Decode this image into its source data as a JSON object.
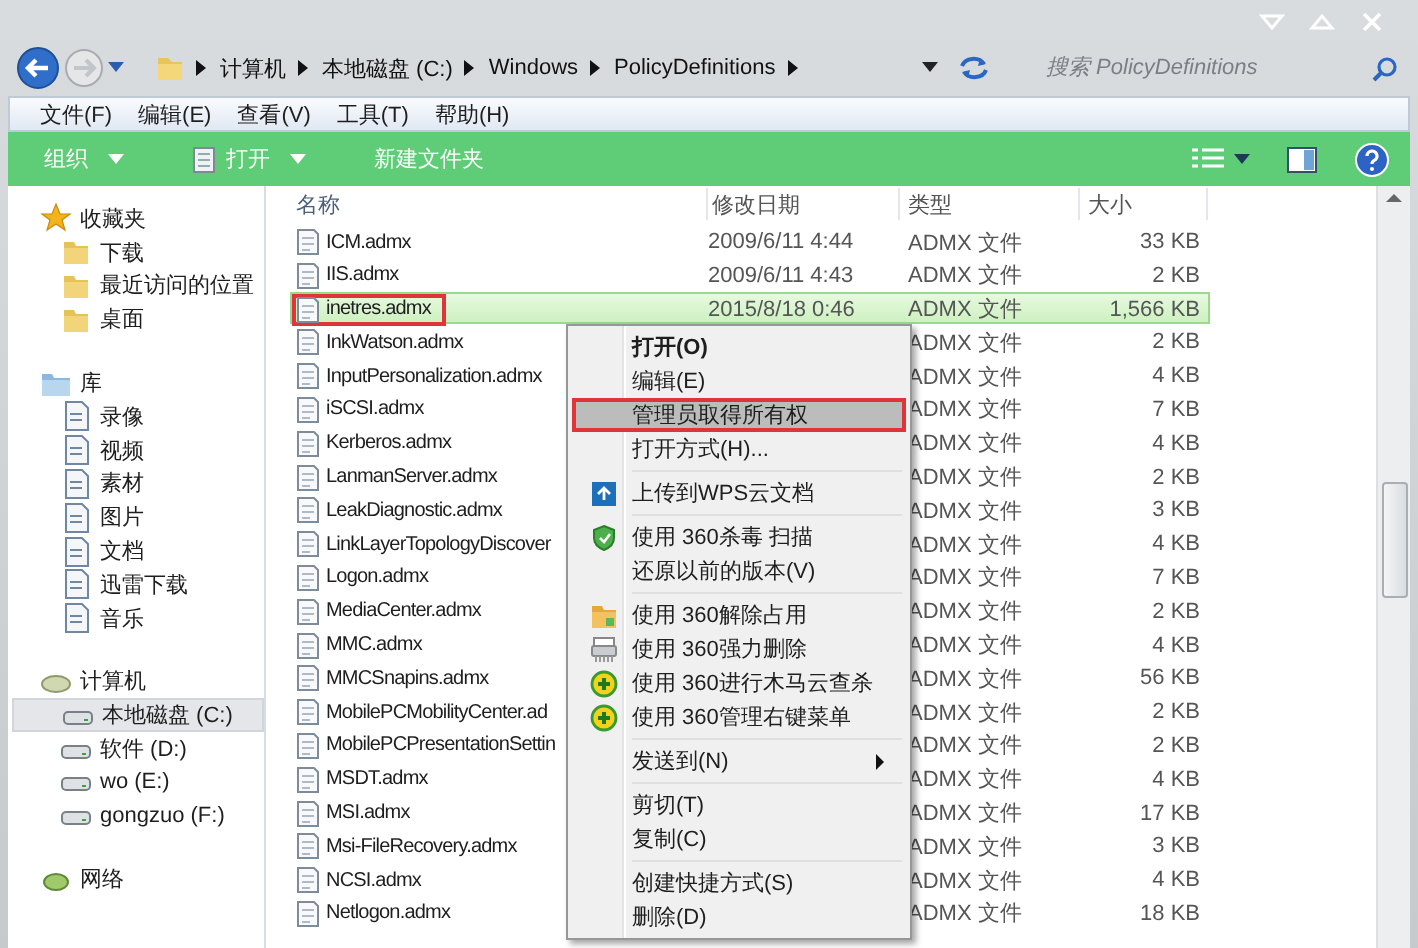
{
  "address_bar": {
    "breadcrumb": [
      "计算机",
      "本地磁盘 (C:)",
      "Windows",
      "PolicyDefinitions"
    ]
  },
  "search": {
    "placeholder": "搜索 PolicyDefinitions"
  },
  "menu_bar": [
    "文件(F)",
    "编辑(E)",
    "查看(V)",
    "工具(T)",
    "帮助(H)"
  ],
  "toolbar": [
    {
      "label": "组织",
      "kind": "plain",
      "dropdown": true
    },
    {
      "label": "打开",
      "kind": "document",
      "dropdown": true
    },
    {
      "label": "新建文件夹",
      "kind": "plain",
      "dropdown": false
    }
  ],
  "sidebar": {
    "groups": [
      {
        "label": "收藏夹",
        "selected": false,
        "children": [
          {
            "label": "下载",
            "selected": false
          },
          {
            "label": "最近访问的位置",
            "selected": false
          },
          {
            "label": "桌面",
            "selected": false
          }
        ]
      },
      {
        "label": "库",
        "selected": false,
        "children": [
          {
            "label": "录像",
            "selected": false
          },
          {
            "label": "视频",
            "selected": false
          },
          {
            "label": "素材",
            "selected": false
          },
          {
            "label": "图片",
            "selected": false
          },
          {
            "label": "文档",
            "selected": false
          },
          {
            "label": "迅雷下载",
            "selected": false
          },
          {
            "label": "音乐",
            "selected": false
          }
        ]
      },
      {
        "label": "计算机",
        "selected": false,
        "children": [
          {
            "label": "本地磁盘 (C:)",
            "selected": true
          },
          {
            "label": "软件 (D:)",
            "selected": false
          },
          {
            "label": "wo (E:)",
            "selected": false
          },
          {
            "label": "gongzuo (F:)",
            "selected": false
          }
        ]
      },
      {
        "label": "网络",
        "selected": false
      }
    ]
  },
  "file_list": {
    "columns": [
      "名称",
      "修改日期",
      "类型",
      "大小"
    ],
    "rows": [
      {
        "name": "ICM.admx",
        "date": "2009/6/11 4:44",
        "type": "ADMX 文件",
        "size": "33 KB",
        "selected": false,
        "marked": false
      },
      {
        "name": "IIS.admx",
        "date": "2009/6/11 4:43",
        "type": "ADMX 文件",
        "size": "2 KB",
        "selected": false,
        "marked": false
      },
      {
        "name": "inetres.admx",
        "date": "2015/8/18 0:46",
        "type": "ADMX 文件",
        "size": "1,566 KB",
        "selected": true,
        "marked": true
      },
      {
        "name": "InkWatson.admx",
        "type": "ADMX 文件",
        "size": "2 KB",
        "selected": false,
        "marked": false
      },
      {
        "name": "InputPersonalization.admx",
        "type": "ADMX 文件",
        "size": "4 KB",
        "selected": false,
        "marked": false
      },
      {
        "name": "iSCSI.admx",
        "type": "ADMX 文件",
        "size": "7 KB",
        "selected": false,
        "marked": false
      },
      {
        "name": "Kerberos.admx",
        "type": "ADMX 文件",
        "size": "4 KB",
        "selected": false,
        "marked": false
      },
      {
        "name": "LanmanServer.admx",
        "type": "ADMX 文件",
        "size": "2 KB",
        "selected": false,
        "marked": false
      },
      {
        "name": "LeakDiagnostic.admx",
        "type": "ADMX 文件",
        "size": "3 KB",
        "selected": false,
        "marked": false
      },
      {
        "name": "LinkLayerTopologyDiscover",
        "type": "ADMX 文件",
        "size": "4 KB",
        "selected": false,
        "marked": false
      },
      {
        "name": "Logon.admx",
        "type": "ADMX 文件",
        "size": "7 KB",
        "selected": false,
        "marked": false
      },
      {
        "name": "MediaCenter.admx",
        "type": "ADMX 文件",
        "size": "2 KB",
        "selected": false,
        "marked": false
      },
      {
        "name": "MMC.admx",
        "type": "ADMX 文件",
        "size": "4 KB",
        "selected": false,
        "marked": false
      },
      {
        "name": "MMCSnapins.admx",
        "type": "ADMX 文件",
        "size": "56 KB",
        "selected": false,
        "marked": false
      },
      {
        "name": "MobilePCMobilityCenter.ad",
        "type": "ADMX 文件",
        "size": "2 KB",
        "selected": false,
        "marked": false
      },
      {
        "name": "MobilePCPresentationSettin",
        "type": "ADMX 文件",
        "size": "2 KB",
        "selected": false,
        "marked": false
      },
      {
        "name": "MSDT.admx",
        "type": "ADMX 文件",
        "size": "4 KB",
        "selected": false,
        "marked": false
      },
      {
        "name": "MSI.admx",
        "type": "ADMX 文件",
        "size": "17 KB",
        "selected": false,
        "marked": false
      },
      {
        "name": "Msi-FileRecovery.admx",
        "type": "ADMX 文件",
        "size": "3 KB",
        "selected": false,
        "marked": false
      },
      {
        "name": "NCSI.admx",
        "type": "ADMX 文件",
        "size": "4 KB",
        "selected": false,
        "marked": false
      },
      {
        "name": "Netlogon.admx",
        "type": "ADMX 文件",
        "size": "18 KB",
        "selected": false,
        "marked": false
      }
    ]
  },
  "context_menu": {
    "items": [
      {
        "kind": "default",
        "label": "打开(O)",
        "highlighted": false,
        "marked": false
      },
      {
        "kind": "plain",
        "label": "编辑(E)",
        "highlighted": false,
        "marked": false
      },
      {
        "kind": "plain",
        "label": "管理员取得所有权",
        "highlighted": true,
        "marked": true
      },
      {
        "kind": "plain",
        "label": "打开方式(H)...",
        "highlighted": false,
        "marked": false
      },
      {
        "kind": "separator"
      },
      {
        "kind": "cloud",
        "label": "上传到WPS云文档",
        "highlighted": false,
        "marked": false
      },
      {
        "kind": "separator"
      },
      {
        "kind": "antivirus",
        "label": "使用 360杀毒 扫描",
        "highlighted": false,
        "marked": false
      },
      {
        "kind": "plain",
        "label": "还原以前的版本(V)",
        "highlighted": false,
        "marked": false
      },
      {
        "kind": "separator"
      },
      {
        "kind": "unlock",
        "label": "使用 360解除占用",
        "highlighted": false,
        "marked": false
      },
      {
        "kind": "shred",
        "label": "使用 360强力删除",
        "highlighted": false,
        "marked": false
      },
      {
        "kind": "plus",
        "label": "使用 360进行木马云查杀",
        "highlighted": false,
        "marked": false
      },
      {
        "kind": "plus",
        "label": "使用 360管理右键菜单",
        "highlighted": false,
        "marked": false
      },
      {
        "kind": "separator"
      },
      {
        "kind": "submenu",
        "label": "发送到(N)",
        "highlighted": false,
        "marked": false
      },
      {
        "kind": "separator"
      },
      {
        "kind": "plain",
        "label": "剪切(T)",
        "highlighted": false,
        "marked": false
      },
      {
        "kind": "plain",
        "label": "复制(C)",
        "highlighted": false,
        "marked": false
      },
      {
        "kind": "separator"
      },
      {
        "kind": "plain",
        "label": "创建快捷方式(S)",
        "highlighted": false,
        "marked": false
      },
      {
        "kind": "plain",
        "label": "删除(D)",
        "highlighted": false,
        "marked": false
      }
    ]
  }
}
